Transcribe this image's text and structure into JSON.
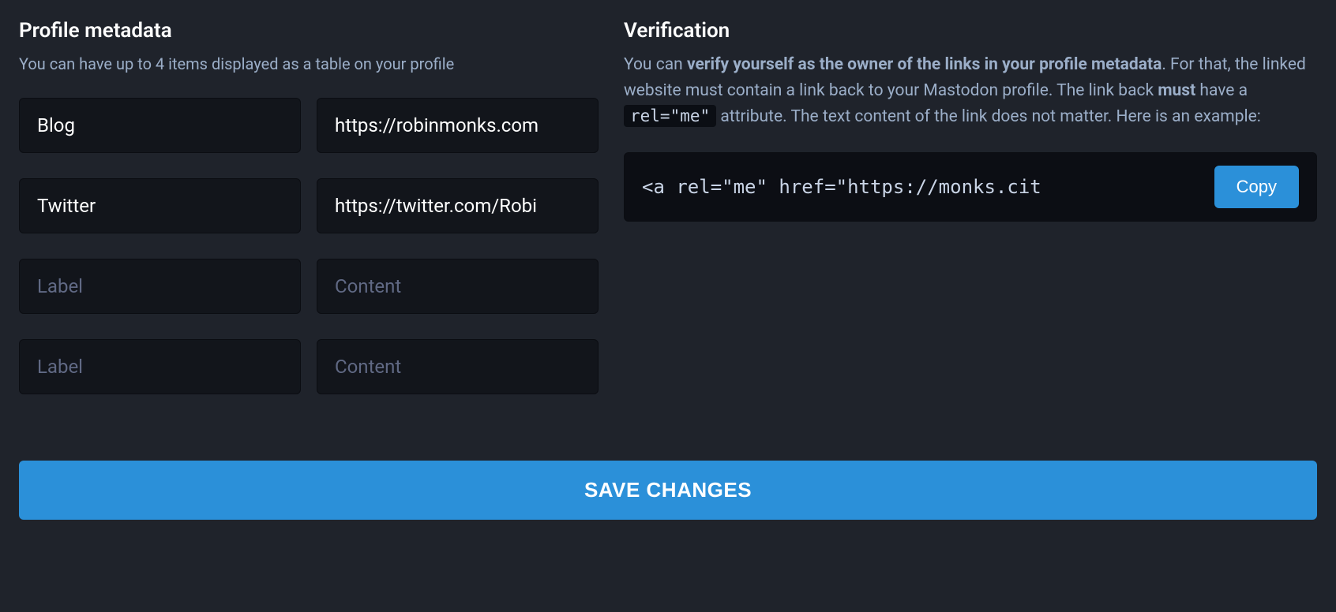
{
  "profile_metadata": {
    "heading": "Profile metadata",
    "hint": "You can have up to 4 items displayed as a table on your profile",
    "label_placeholder": "Label",
    "content_placeholder": "Content",
    "fields": [
      {
        "label": "Blog",
        "content": "https://robinmonks.com"
      },
      {
        "label": "Twitter",
        "content": "https://twitter.com/Robi"
      },
      {
        "label": "",
        "content": ""
      },
      {
        "label": "",
        "content": ""
      }
    ]
  },
  "verification": {
    "heading": "Verification",
    "text_parts": {
      "p1": "You can ",
      "b1": "verify yourself as the owner of the links in your profile metadata",
      "p2": ". For that, the linked website must contain a link back to your Mastodon profile. The link back ",
      "b2": "must",
      "p3": " have a ",
      "code": "rel=\"me\"",
      "p4": " attribute. The text content of the link does not matter. Here is an example:"
    },
    "example_code": "<a rel=\"me\" href=\"https://monks.cit",
    "copy_label": "Copy"
  },
  "save_label": "SAVE CHANGES"
}
